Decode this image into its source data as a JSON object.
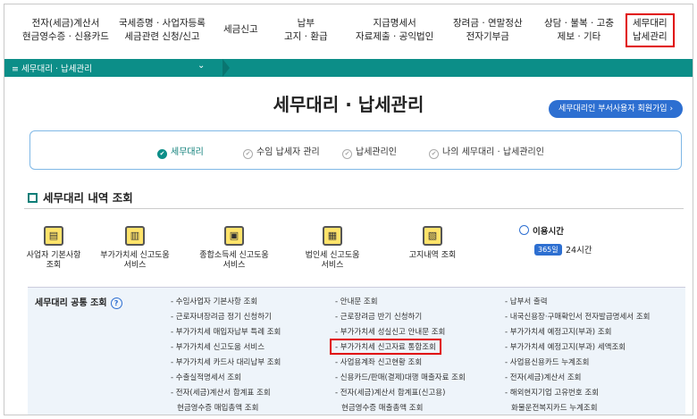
{
  "topmenu": [
    {
      "line1": "전자(세금)계산서",
      "line2": "현금영수증 · 신용카드"
    },
    {
      "line1": "국세증명 · 사업자등록",
      "line2": "세금관련 신청/신고"
    },
    {
      "line1": "세금신고",
      "line2": ""
    },
    {
      "line1": "납부",
      "line2": "고지 · 환급"
    },
    {
      "line1": "지급명세서",
      "line2": "자료제출 · 공익법인"
    },
    {
      "line1": "장려금 · 연말정산",
      "line2": "전자기부금"
    },
    {
      "line1": "상담 · 불복 · 고충",
      "line2": "제보 · 기타"
    },
    {
      "line1": "세무대리",
      "line2": "납세관리"
    }
  ],
  "breadcrumb": {
    "label": "≡  세무대리 · 납세관리",
    "chevron": "⌄"
  },
  "page": {
    "title": "세무대리 · 납세관리",
    "join_button": "세무대리인 부서사용자 회원가입  ›"
  },
  "steps": [
    {
      "label": "세무대리",
      "mark": "✔"
    },
    {
      "label": "수임 납세자 관리",
      "mark": "✔"
    },
    {
      "label": "납세관리인",
      "mark": "✔"
    },
    {
      "label": "나의 세무대리 · 납세관리인",
      "mark": "✔"
    }
  ],
  "section": {
    "title": "세무대리 내역 조회"
  },
  "services": [
    {
      "label1": "사업자 기본사항",
      "label2": "조회",
      "icon": "document-person-icon",
      "glyph": "▤"
    },
    {
      "label1": "부가가치세 신고도움",
      "label2": "서비스",
      "icon": "receipt-icon",
      "glyph": "▥"
    },
    {
      "label1": "종합소득세 신고도움",
      "label2": "서비스",
      "icon": "tax-paper-icon",
      "glyph": "▣"
    },
    {
      "label1": "법인세 신고도움",
      "label2": "서비스",
      "icon": "check-document-icon",
      "glyph": "▦"
    },
    {
      "label1": "고지내역 조회",
      "label2": "",
      "icon": "wallet-icon",
      "glyph": "▧"
    }
  ],
  "usetime": {
    "label": "이용시간",
    "badge": "365일",
    "hours": "24시간"
  },
  "common": {
    "title": "세무대리 공통 조회",
    "help": "?",
    "col1": [
      "- 수임사업자 기본사항 조회",
      "- 근로자녀장려금 정기 신청하기",
      "- 부가가치세 매입자납부 특례 조회",
      "- 부가가치세 신고도움 서비스",
      "- 부가가치세 카드사 대리납부 조회",
      "- 수출실적명세서 조회",
      "- 전자(세금)계산서 합계표 조회",
      "현금영수증 매입총액 조회"
    ],
    "col2": [
      "- 안내문 조회",
      "- 근로장려금 반기 신청하기",
      "- 부가가치세 성실신고 안내문 조회",
      "- 부가가치세 신고자료 통합조회",
      "- 사업용계좌 신고현황 조회",
      "- 신용카드/판매(결제)대행 매출자료 조회",
      "- 전자(세금)계산서 합계표(신고용)",
      "현금영수증 매출총액 조회"
    ],
    "col3": [
      "- 납부서 출력",
      "- 내국신용장·구매확인서 전자발급명세서 조회",
      "- 부가가치세 예정고지(부과) 조회",
      "- 부가가치세 예정고지(부과) 세액조회",
      "- 사업용신용카드 누계조회",
      "- 전자(세금)계산서 조회",
      "- 해외현지기업 고유번호 조회",
      "화물운전복지카드 누계조회"
    ]
  }
}
